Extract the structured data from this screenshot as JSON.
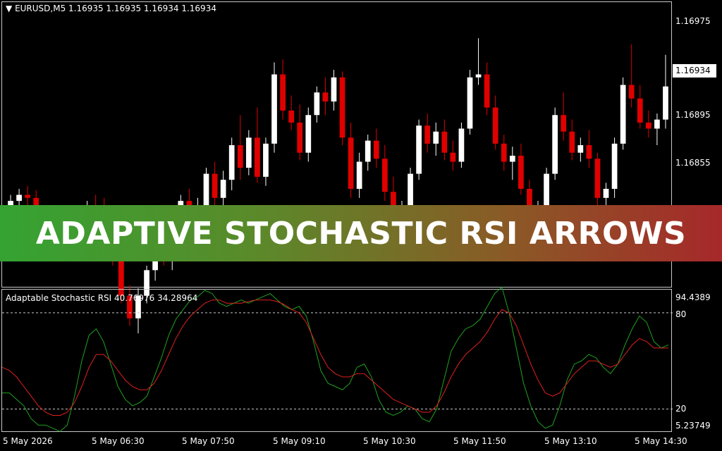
{
  "header": {
    "symbol_line": "EURUSD,M5  1.16935 1.16935 1.16934 1.16934"
  },
  "indicator": {
    "info_line": "Adaptable Stochastic RSI 40.76976 34.28964",
    "levels": {
      "upper": 80,
      "lower": 20
    },
    "scale_top": "94.4389",
    "scale_bottom": "5.23749",
    "level_upper_label": "80",
    "level_lower_label": "20",
    "colors": {
      "main": "#1fa21f",
      "signal": "#e02020"
    }
  },
  "price_axis": {
    "labels": [
      "1.16975",
      "1.16934",
      "1.16895",
      "1.16855"
    ],
    "current_price": "1.16934"
  },
  "time_axis": {
    "labels": [
      "5 May 2026",
      "5 May 06:30",
      "5 May 07:50",
      "5 May 09:10",
      "5 May 10:30",
      "5 May 11:50",
      "5 May 13:10",
      "5 May 14:30"
    ]
  },
  "banner": {
    "title": "ADAPTIVE STOCHASTIC RSI ARROWS"
  },
  "colors": {
    "bull": "#ffffff",
    "bear": "#e00000",
    "grid_dash": "#c8c8c8"
  },
  "chart_data": [
    {
      "type": "candlestick",
      "title": "EURUSD,M5",
      "ylim": [
        1.168,
        1.1699
      ],
      "y_ticks": [
        1.16975,
        1.16934,
        1.16895,
        1.16855
      ],
      "candles": [
        [
          1.1685,
          1.16862,
          1.16845,
          1.16858
        ],
        [
          1.16858,
          1.16866,
          1.16852,
          1.16862
        ],
        [
          1.16862,
          1.16868,
          1.16855,
          1.1686
        ],
        [
          1.1686,
          1.16865,
          1.16845,
          1.16848
        ],
        [
          1.16848,
          1.16855,
          1.1684,
          1.16845
        ],
        [
          1.16845,
          1.1685,
          1.16832,
          1.16836
        ],
        [
          1.16836,
          1.16845,
          1.16828,
          1.16842
        ],
        [
          1.16842,
          1.1685,
          1.16835,
          1.16845
        ],
        [
          1.16845,
          1.16852,
          1.16838,
          1.16848
        ],
        [
          1.16848,
          1.16858,
          1.16843,
          1.16852
        ],
        [
          1.16852,
          1.16862,
          1.16845,
          1.1685
        ],
        [
          1.1685,
          1.1686,
          1.1684,
          1.16846
        ],
        [
          1.16846,
          1.16848,
          1.16815,
          1.1682
        ],
        [
          1.1682,
          1.1683,
          1.1679,
          1.16795
        ],
        [
          1.16795,
          1.16802,
          1.16775,
          1.1678
        ],
        [
          1.1678,
          1.168,
          1.1677,
          1.16795
        ],
        [
          1.16795,
          1.16815,
          1.1679,
          1.16812
        ],
        [
          1.16812,
          1.16826,
          1.16805,
          1.16822
        ],
        [
          1.16822,
          1.16832,
          1.16815,
          1.16818
        ],
        [
          1.16818,
          1.1684,
          1.16812,
          1.16836
        ],
        [
          1.16836,
          1.16862,
          1.1683,
          1.16858
        ],
        [
          1.16858,
          1.16866,
          1.1682,
          1.16826
        ],
        [
          1.16826,
          1.1686,
          1.16822,
          1.16855
        ],
        [
          1.16855,
          1.1688,
          1.1685,
          1.16876
        ],
        [
          1.16876,
          1.16884,
          1.16855,
          1.1686
        ],
        [
          1.1686,
          1.16878,
          1.16852,
          1.16872
        ],
        [
          1.16872,
          1.169,
          1.16865,
          1.16895
        ],
        [
          1.16895,
          1.16915,
          1.16872,
          1.1688
        ],
        [
          1.1688,
          1.16905,
          1.16875,
          1.169
        ],
        [
          1.169,
          1.1692,
          1.1687,
          1.16874
        ],
        [
          1.16874,
          1.169,
          1.16868,
          1.16896
        ],
        [
          1.16896,
          1.1695,
          1.1689,
          1.16942
        ],
        [
          1.16942,
          1.16952,
          1.16912,
          1.16918
        ],
        [
          1.16918,
          1.16928,
          1.16905,
          1.1691
        ],
        [
          1.1691,
          1.16922,
          1.16885,
          1.1689
        ],
        [
          1.1689,
          1.1692,
          1.16884,
          1.16915
        ],
        [
          1.16915,
          1.16934,
          1.1691,
          1.1693
        ],
        [
          1.1693,
          1.1694,
          1.16915,
          1.16924
        ],
        [
          1.16924,
          1.16945,
          1.16918,
          1.1694
        ],
        [
          1.1694,
          1.16944,
          1.16895,
          1.169
        ],
        [
          1.169,
          1.1691,
          1.1686,
          1.16866
        ],
        [
          1.16866,
          1.1689,
          1.1686,
          1.16884
        ],
        [
          1.16884,
          1.16902,
          1.16878,
          1.16898
        ],
        [
          1.16898,
          1.16906,
          1.1688,
          1.16886
        ],
        [
          1.16886,
          1.16895,
          1.16858,
          1.16864
        ],
        [
          1.16864,
          1.16874,
          1.1682,
          1.16826
        ],
        [
          1.16826,
          1.16858,
          1.1682,
          1.16852
        ],
        [
          1.16852,
          1.1688,
          1.16848,
          1.16876
        ],
        [
          1.16876,
          1.16912,
          1.16872,
          1.16908
        ],
        [
          1.16908,
          1.16916,
          1.1689,
          1.16896
        ],
        [
          1.16896,
          1.1691,
          1.16888,
          1.16904
        ],
        [
          1.16904,
          1.16912,
          1.16885,
          1.1689
        ],
        [
          1.1689,
          1.16898,
          1.16878,
          1.16884
        ],
        [
          1.16884,
          1.1691,
          1.1688,
          1.16906
        ],
        [
          1.16906,
          1.16945,
          1.16902,
          1.1694
        ],
        [
          1.1694,
          1.16966,
          1.16935,
          1.16942
        ],
        [
          1.16942,
          1.1695,
          1.16915,
          1.1692
        ],
        [
          1.1692,
          1.16928,
          1.16892,
          1.16896
        ],
        [
          1.16896,
          1.16902,
          1.16878,
          1.16884
        ],
        [
          1.16884,
          1.16894,
          1.16872,
          1.16888
        ],
        [
          1.16888,
          1.16896,
          1.16862,
          1.16866
        ],
        [
          1.16866,
          1.16872,
          1.16845,
          1.1685
        ],
        [
          1.1685,
          1.16858,
          1.16838,
          1.16854
        ],
        [
          1.16854,
          1.1688,
          1.16848,
          1.16876
        ],
        [
          1.16876,
          1.1692,
          1.16872,
          1.16915
        ],
        [
          1.16915,
          1.1693,
          1.16898,
          1.16904
        ],
        [
          1.16904,
          1.16912,
          1.16885,
          1.1689
        ],
        [
          1.1689,
          1.169,
          1.16884,
          1.16895
        ],
        [
          1.16895,
          1.16905,
          1.1688,
          1.16886
        ],
        [
          1.16886,
          1.1689,
          1.16855,
          1.1686
        ],
        [
          1.1686,
          1.1687,
          1.16848,
          1.16866
        ],
        [
          1.16866,
          1.169,
          1.1686,
          1.16896
        ],
        [
          1.16896,
          1.1694,
          1.16892,
          1.16935
        ],
        [
          1.16935,
          1.16962,
          1.1692,
          1.16926
        ],
        [
          1.16926,
          1.16935,
          1.16906,
          1.1691
        ],
        [
          1.1691,
          1.16918,
          1.169,
          1.16906
        ],
        [
          1.16906,
          1.16916,
          1.16895,
          1.16912
        ],
        [
          1.16912,
          1.16955,
          1.16906,
          1.16934
        ]
      ]
    },
    {
      "type": "line",
      "title": "Adaptable Stochastic RSI",
      "ylim": [
        5.23749,
        94.4389
      ],
      "series": [
        {
          "values": [
            30,
            30,
            26,
            22,
            14,
            10,
            10,
            8,
            6,
            10,
            28,
            50,
            66,
            70,
            62,
            48,
            34,
            26,
            22,
            24,
            28,
            40,
            52,
            66,
            76,
            82,
            88,
            90,
            94,
            92,
            86,
            84,
            86,
            88,
            86,
            88,
            90,
            92,
            88,
            84,
            82,
            84,
            78,
            62,
            44,
            36,
            34,
            32,
            36,
            46,
            48,
            40,
            26,
            18,
            16,
            18,
            22,
            20,
            14,
            12,
            20,
            38,
            56,
            64,
            70,
            72,
            76,
            84,
            92,
            96,
            80,
            58,
            36,
            22,
            12,
            8,
            10,
            22,
            38,
            48,
            50,
            54,
            52,
            46,
            42,
            48,
            60,
            70,
            78,
            74,
            62,
            58,
            60
          ]
        },
        {
          "values": [
            46,
            44,
            40,
            34,
            28,
            22,
            18,
            16,
            16,
            18,
            24,
            34,
            46,
            54,
            54,
            50,
            44,
            38,
            34,
            32,
            32,
            36,
            44,
            54,
            64,
            72,
            78,
            82,
            86,
            88,
            88,
            86,
            86,
            86,
            87,
            88,
            88,
            88,
            87,
            85,
            82,
            80,
            74,
            64,
            54,
            46,
            42,
            40,
            40,
            42,
            42,
            38,
            34,
            30,
            26,
            24,
            22,
            20,
            18,
            18,
            22,
            30,
            40,
            48,
            54,
            58,
            62,
            68,
            76,
            82,
            80,
            72,
            60,
            48,
            38,
            30,
            28,
            30,
            36,
            42,
            46,
            50,
            50,
            48,
            46,
            48,
            54,
            60,
            64,
            62,
            58,
            58,
            58
          ]
        }
      ]
    }
  ]
}
